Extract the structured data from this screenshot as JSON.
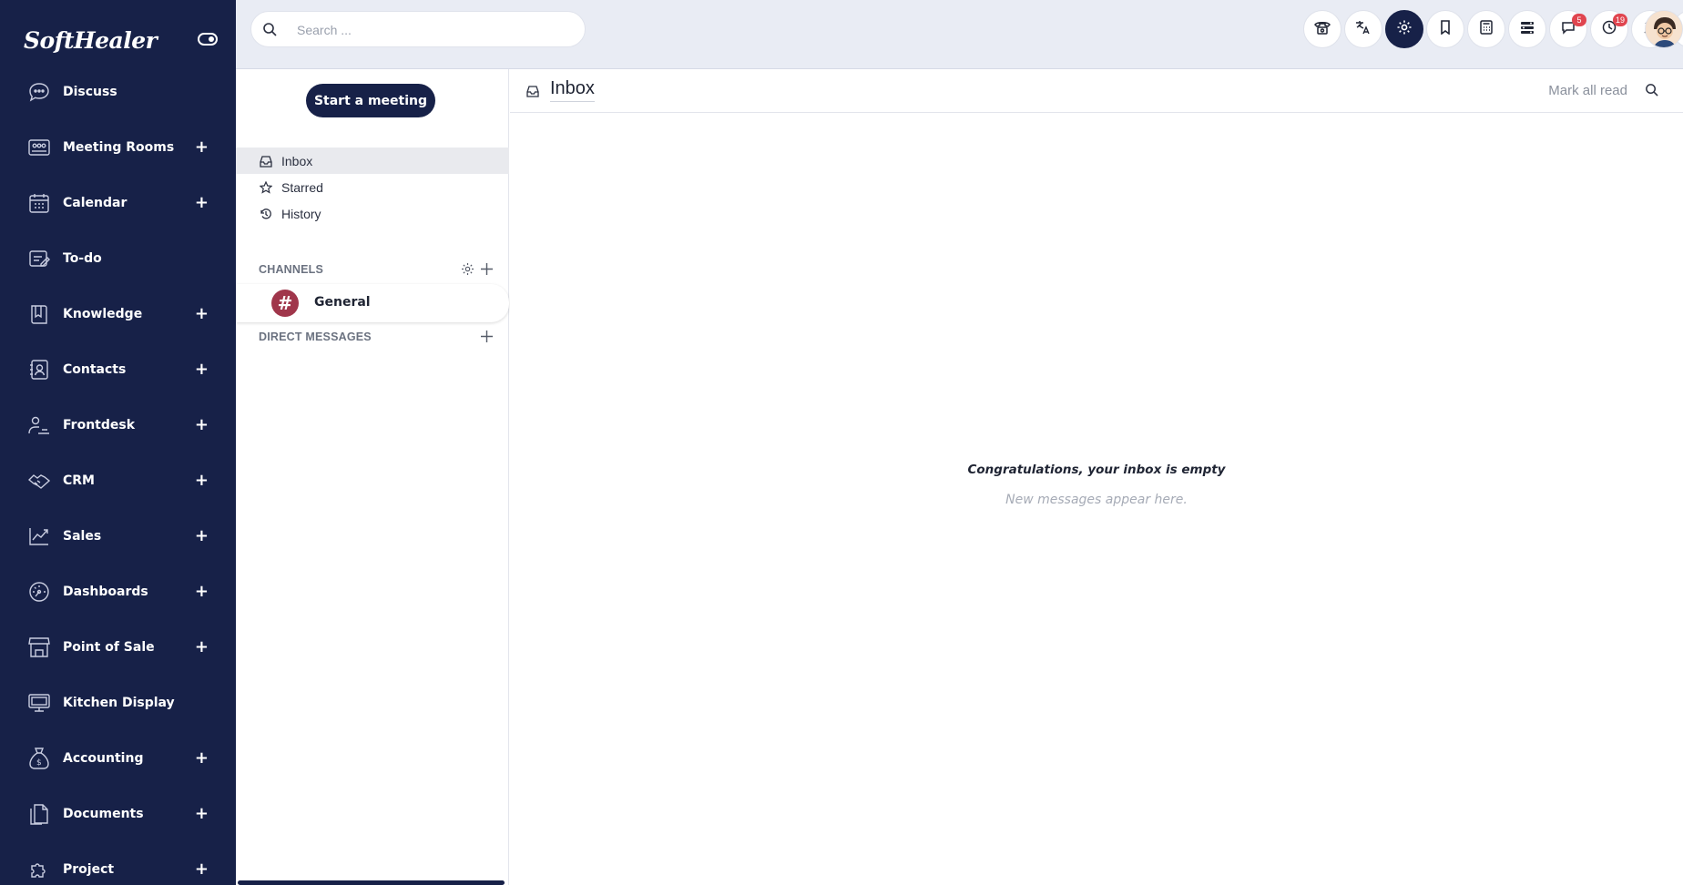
{
  "brand": {
    "logo_text": "SoftHealer"
  },
  "sidebar": {
    "items": [
      {
        "label": "Discuss",
        "icon": "discuss-icon",
        "expandable": false
      },
      {
        "label": "Meeting Rooms",
        "icon": "meeting-rooms-icon",
        "expandable": true
      },
      {
        "label": "Calendar",
        "icon": "calendar-icon",
        "expandable": true
      },
      {
        "label": "To-do",
        "icon": "todo-icon",
        "expandable": false
      },
      {
        "label": "Knowledge",
        "icon": "knowledge-icon",
        "expandable": true
      },
      {
        "label": "Contacts",
        "icon": "contacts-icon",
        "expandable": true
      },
      {
        "label": "Frontdesk",
        "icon": "frontdesk-icon",
        "expandable": true
      },
      {
        "label": "CRM",
        "icon": "crm-icon",
        "expandable": true
      },
      {
        "label": "Sales",
        "icon": "sales-icon",
        "expandable": true
      },
      {
        "label": "Dashboards",
        "icon": "dashboards-icon",
        "expandable": true
      },
      {
        "label": "Point of Sale",
        "icon": "point-of-sale-icon",
        "expandable": true
      },
      {
        "label": "Kitchen Display",
        "icon": "kitchen-display-icon",
        "expandable": false
      },
      {
        "label": "Accounting",
        "icon": "accounting-icon",
        "expandable": true
      },
      {
        "label": "Documents",
        "icon": "documents-icon",
        "expandable": true
      },
      {
        "label": "Project",
        "icon": "project-icon",
        "expandable": true
      }
    ],
    "plus_symbol": "+"
  },
  "topbar": {
    "search_placeholder": "Search ...",
    "badges": {
      "messages": "5",
      "activities": "19"
    }
  },
  "discuss": {
    "start_meeting_label": "Start a meeting",
    "mailboxes": [
      {
        "label": "Inbox",
        "icon": "inbox-icon",
        "active": true
      },
      {
        "label": "Starred",
        "icon": "star-icon",
        "active": false
      },
      {
        "label": "History",
        "icon": "history-icon",
        "active": false
      }
    ],
    "channels_heading": "CHANNELS",
    "channels": [
      {
        "name": "General",
        "avatar_symbol": "#"
      }
    ],
    "direct_messages_heading": "DIRECT MESSAGES"
  },
  "thread": {
    "title": "Inbox",
    "mark_all_read_label": "Mark all read",
    "empty_title": "Congratulations, your inbox is empty",
    "empty_subtitle": "New messages appear here."
  },
  "colors": {
    "sidebar_bg": "#172148",
    "accent": "#172148",
    "channel_avatar": "#a0364b",
    "badge": "#e0454f"
  }
}
